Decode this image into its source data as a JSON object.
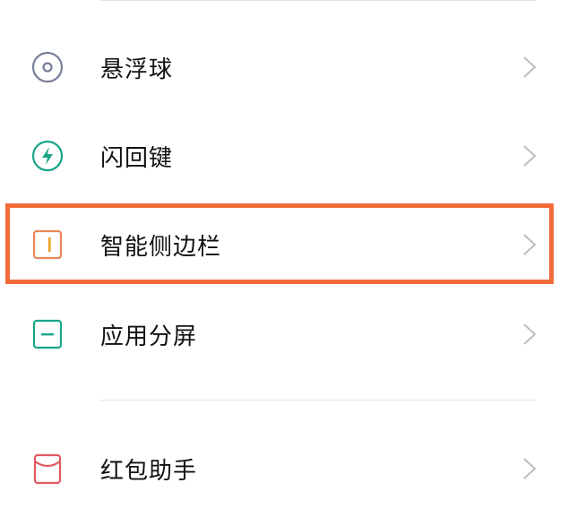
{
  "settings_list": {
    "items": [
      {
        "label": "悬浮球",
        "icon": "floating-ball-icon",
        "color": "#7a7f9a"
      },
      {
        "label": "闪回键",
        "icon": "flashback-key-icon",
        "color": "#1aa58a"
      },
      {
        "label": "智能侧边栏",
        "icon": "smart-sidebar-icon",
        "color": "#e8875a"
      },
      {
        "label": "应用分屏",
        "icon": "split-screen-icon",
        "color": "#1aa58a"
      },
      {
        "label": "红包助手",
        "icon": "red-envelope-icon",
        "color": "#e05a63"
      }
    ]
  },
  "highlight": {
    "color": "#f26c3b",
    "target": "智能侧边栏"
  },
  "chevron_color": "#bdbdbd",
  "divider_color": "#e4e4e4"
}
